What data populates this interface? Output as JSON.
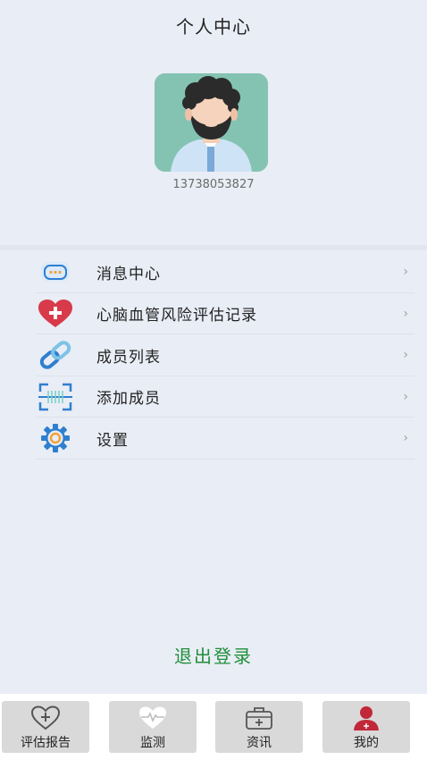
{
  "header": {
    "title": "个人中心"
  },
  "profile": {
    "phone": "13738053827"
  },
  "menu": {
    "items": [
      {
        "label": "消息中心",
        "icon": "message-icon",
        "chevron": "›"
      },
      {
        "label": "心脑血管风险评估记录",
        "icon": "heart-plus-icon",
        "chevron": "›"
      },
      {
        "label": "成员列表",
        "icon": "link-icon",
        "chevron": "›"
      },
      {
        "label": "添加成员",
        "icon": "scan-icon",
        "chevron": "›"
      },
      {
        "label": "设置",
        "icon": "gear-icon",
        "chevron": "›"
      }
    ]
  },
  "logout": {
    "label": "退出登录"
  },
  "tabbar": {
    "items": [
      {
        "label": "评估报告",
        "icon": "heart-plus-outline-icon"
      },
      {
        "label": "监测",
        "icon": "heartbeat-icon"
      },
      {
        "label": "资讯",
        "icon": "medical-kit-icon"
      },
      {
        "label": "我的",
        "icon": "user-icon"
      }
    ]
  },
  "colors": {
    "background": "#e9edf5",
    "logout_text": "#1f8f3a",
    "avatar_bg": "#84c3b2",
    "heart_red": "#d83a4a",
    "icon_blue": "#2f7fd0",
    "user_red": "#c0283a"
  }
}
